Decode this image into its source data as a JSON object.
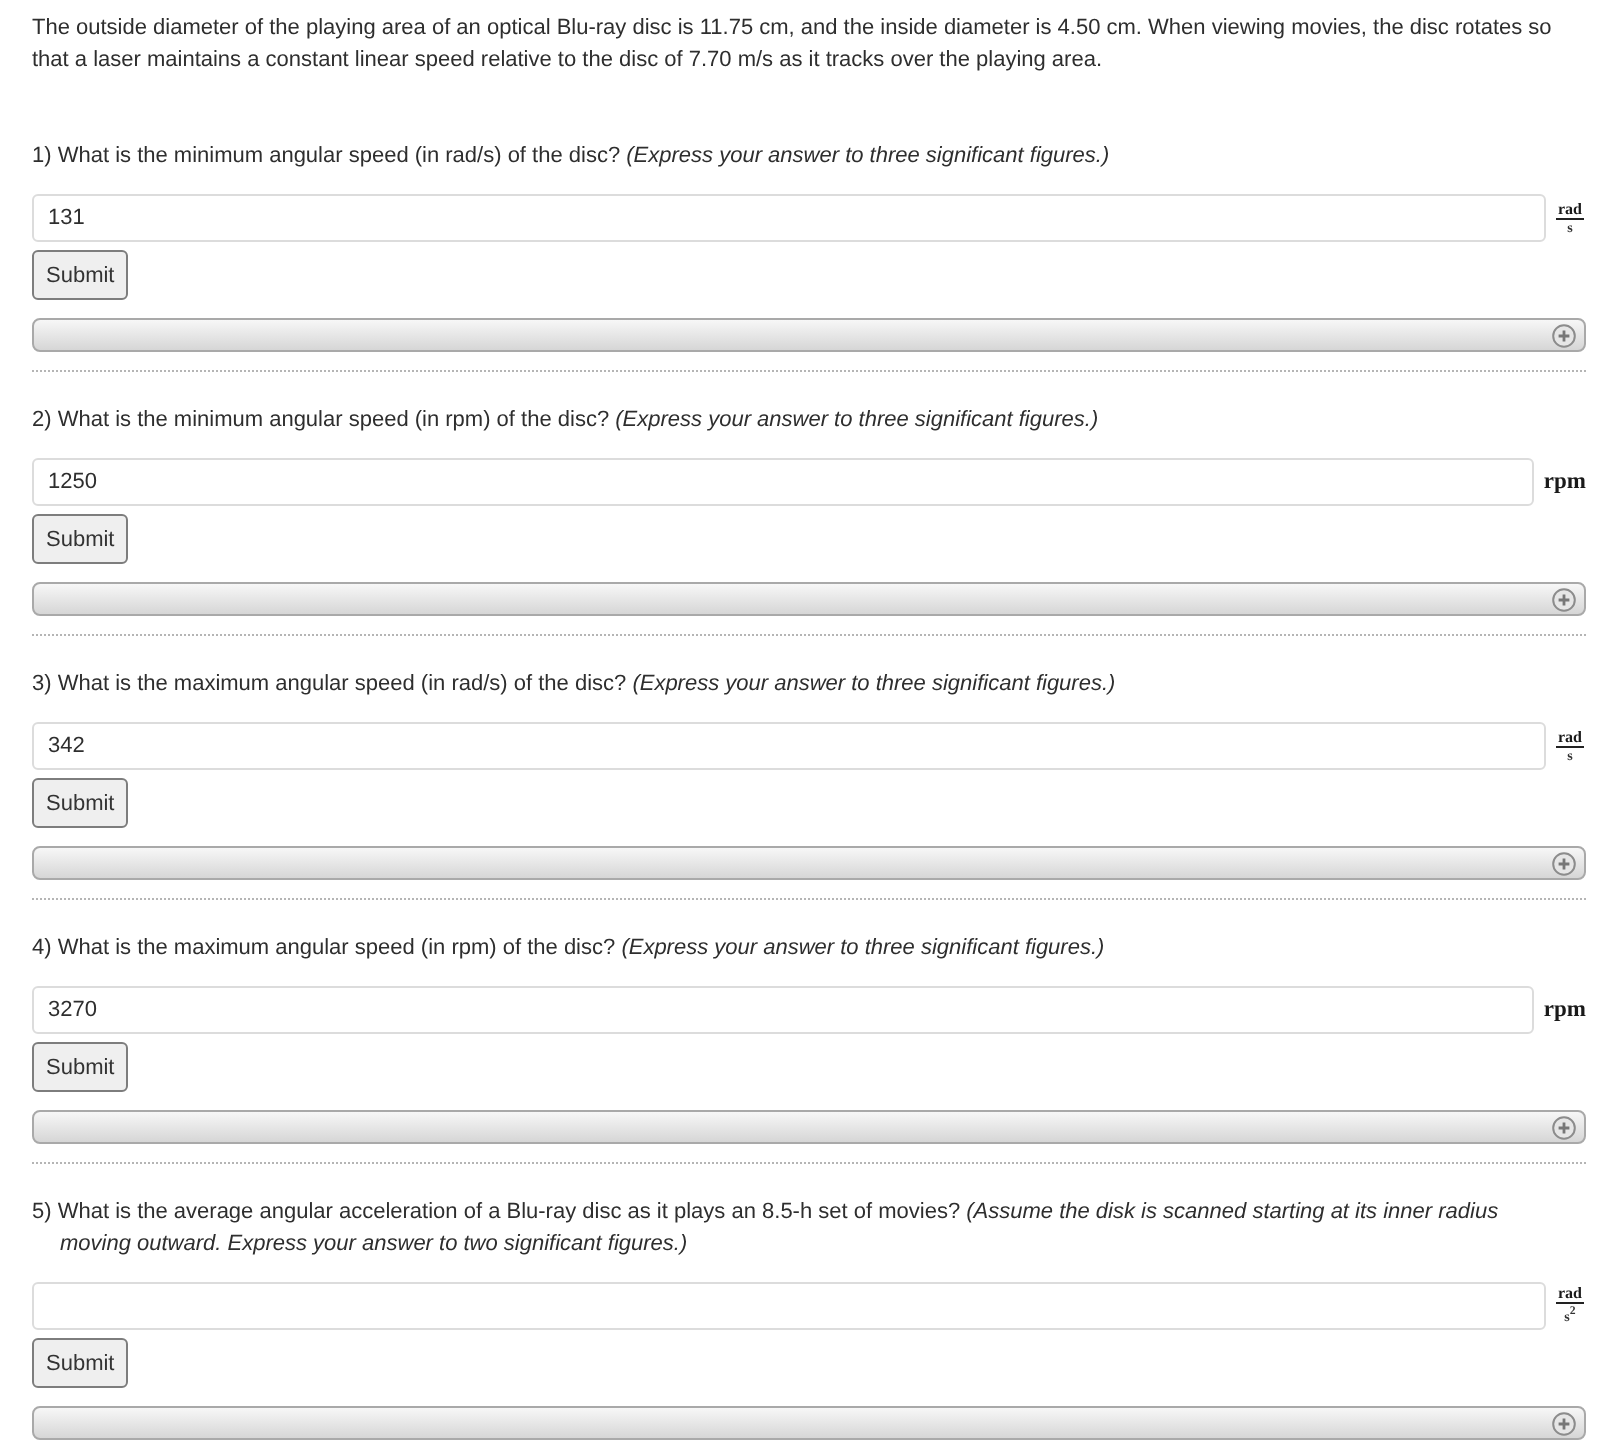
{
  "intro": "The outside diameter of the playing area of an optical Blu-ray disc is 11.75 cm, and the inside diameter is 4.50 cm. When viewing movies, the disc rotates so that a laser maintains a constant linear speed relative to the disc of 7.70 m/s as it tracks over the playing area.",
  "questions": [
    {
      "prompt": "1) What is the minimum angular speed (in rad/s) of the disc? *(Express your answer to three significant figures.)*",
      "answer": "131",
      "unit": {
        "kind": "fraction",
        "numerator": "rad",
        "denominator": "s"
      },
      "submit": "Submit",
      "solution_panel": {
        "expanded": false
      }
    },
    {
      "prompt": "2) What is the minimum angular speed (in rpm) of the disc? *(Express your answer to three significant figures.)*",
      "answer": "1250",
      "unit": {
        "kind": "plain",
        "text": "rpm"
      },
      "submit": "Submit",
      "solution_panel": {
        "expanded": false
      }
    },
    {
      "prompt": "3) What is the maximum angular speed (in rad/s) of the disc? *(Express your answer to three significant figures.)*",
      "answer": "342",
      "unit": {
        "kind": "fraction",
        "numerator": "rad",
        "denominator": "s"
      },
      "submit": "Submit",
      "solution_panel": {
        "expanded": false
      }
    },
    {
      "prompt": "4) What is the maximum angular speed (in rpm) of the disc? *(Express your answer to three significant figures.)*",
      "answer": "3270",
      "unit": {
        "kind": "plain",
        "text": "rpm"
      },
      "submit": "Submit",
      "solution_panel": {
        "expanded": false
      }
    },
    {
      "prompt": "5) What is the average angular acceleration of a Blu-ray disc as it plays an 8.5-h set of movies? *(Assume the disk is scanned starting at its inner radius moving outward. Express your answer to two significant figures.)*",
      "unit": {
        "kind": "fraction",
        "numerator": "rad",
        "denominator": "s$^{2}$"
      },
      "submit": "Submit",
      "solution_panel": {
        "expanded": false
      }
    }
  ]
}
